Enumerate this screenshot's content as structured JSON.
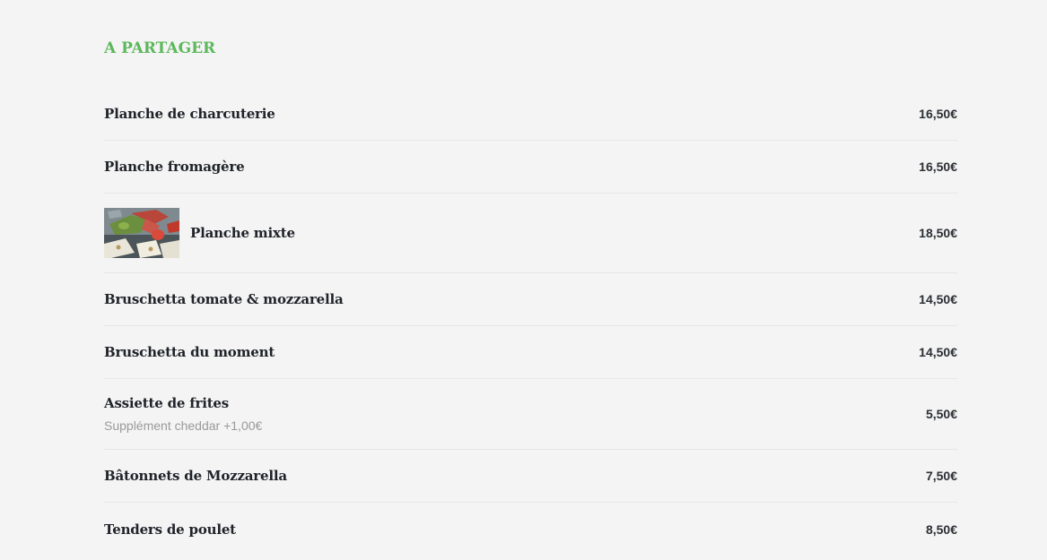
{
  "section": {
    "title": "A PARTAGER"
  },
  "items": [
    {
      "name": "Planche de charcuterie",
      "price": "16,50€",
      "description": ""
    },
    {
      "name": "Planche fromagère",
      "price": "16,50€",
      "description": ""
    },
    {
      "name": "Planche mixte",
      "price": "18,50€",
      "description": "",
      "has_image": true
    },
    {
      "name": "Bruschetta tomate & mozzarella",
      "price": "14,50€",
      "description": ""
    },
    {
      "name": "Bruschetta du moment",
      "price": "14,50€",
      "description": ""
    },
    {
      "name": "Assiette de frites",
      "price": "5,50€",
      "description": "Supplément cheddar +1,00€"
    },
    {
      "name": "Bâtonnets de Mozzarella",
      "price": "7,50€",
      "description": ""
    },
    {
      "name": "Tenders de poulet",
      "price": "8,50€",
      "description": ""
    }
  ],
  "colors": {
    "background": "#f4f4f4",
    "accent": "#5cb85c",
    "text": "#1f2228",
    "muted": "#9a9a9a",
    "divider": "#e6e6e6"
  }
}
